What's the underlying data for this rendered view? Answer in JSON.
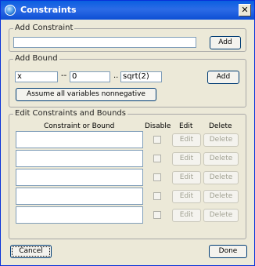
{
  "window": {
    "title": "Constraints",
    "close_glyph": "✕"
  },
  "add_constraint": {
    "group_label": "Add Constraint",
    "input_value": "",
    "add_label": "Add"
  },
  "add_bound": {
    "group_label": "Add Bound",
    "variable_value": "x",
    "lower_sep": "--",
    "lower_value": "0",
    "range_sep": "..",
    "upper_value": "sqrt(2)",
    "add_label": "Add",
    "nonnegative_label": "Assume all variables nonnegative"
  },
  "edit_section": {
    "group_label": "Edit Constraints and Bounds",
    "headers": {
      "constraint": "Constraint or Bound",
      "disable": "Disable",
      "edit": "Edit",
      "delete": "Delete"
    },
    "rows": [
      {
        "value": "",
        "disabled": false,
        "edit_label": "Edit",
        "delete_label": "Delete"
      },
      {
        "value": "",
        "disabled": false,
        "edit_label": "Edit",
        "delete_label": "Delete"
      },
      {
        "value": "",
        "disabled": false,
        "edit_label": "Edit",
        "delete_label": "Delete"
      },
      {
        "value": "",
        "disabled": false,
        "edit_label": "Edit",
        "delete_label": "Delete"
      },
      {
        "value": "",
        "disabled": false,
        "edit_label": "Edit",
        "delete_label": "Delete"
      }
    ]
  },
  "footer": {
    "cancel_label": "Cancel",
    "done_label": "Done"
  }
}
